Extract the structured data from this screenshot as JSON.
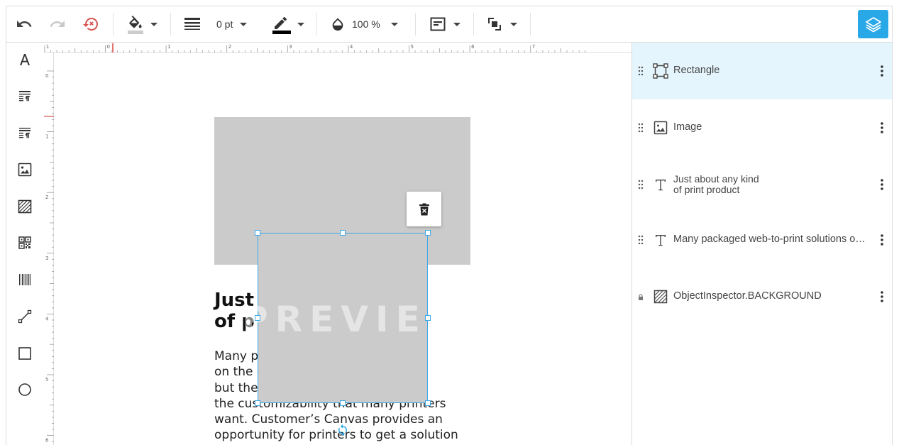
{
  "toolbar": {
    "stroke_width": "0 pt",
    "opacity": "100 %",
    "fill_color": "#cccccc",
    "stroke_color": "#000000",
    "accent": "#29a8e8",
    "icons": [
      "undo-icon",
      "redo-icon",
      "revert-icon",
      "fill-bucket-icon",
      "line-weight-icon",
      "pen-icon",
      "opacity-drop-icon",
      "align-icon",
      "arrange-icon",
      "layers-icon"
    ]
  },
  "left_tools": [
    "text-tool-icon",
    "rich-text-tool-icon",
    "rich-text-alt-tool-icon",
    "image-tool-icon",
    "background-tool-icon",
    "qr-code-tool-icon",
    "barcode-tool-icon",
    "line-tool-icon",
    "rectangle-tool-icon",
    "ellipse-tool-icon"
  ],
  "ruler": {
    "h_labels": [
      "1",
      "0",
      "1",
      "2",
      "3",
      "4",
      "5",
      "6",
      "7"
    ],
    "v_labels": [
      "0",
      "1",
      "2",
      "3",
      "4",
      "5",
      "6"
    ]
  },
  "canvas": {
    "heading": "Just\nof p",
    "body": "Many p                                   tions\non the                                  ough,\nbut the                                   vent\nthe customizability that many printers\nwant. Customer’s Canvas provides an\nopportunity for printers to get a solution",
    "watermark": "PREVIEW"
  },
  "layers": [
    {
      "name": "Rectangle",
      "icon": "rectangle-layer-icon",
      "active": true
    },
    {
      "name": "Image",
      "icon": "image-layer-icon",
      "active": false
    },
    {
      "name_line1": "Just about any kind",
      "name_line2": "of print product",
      "icon": "text-layer-icon",
      "active": false
    },
    {
      "name": "Many packaged web-to-print solutions o…",
      "icon": "text-layer-icon",
      "active": false
    },
    {
      "name": "ObjectInspector.BACKGROUND",
      "icon": "background-layer-icon",
      "locked": true,
      "active": false
    }
  ]
}
